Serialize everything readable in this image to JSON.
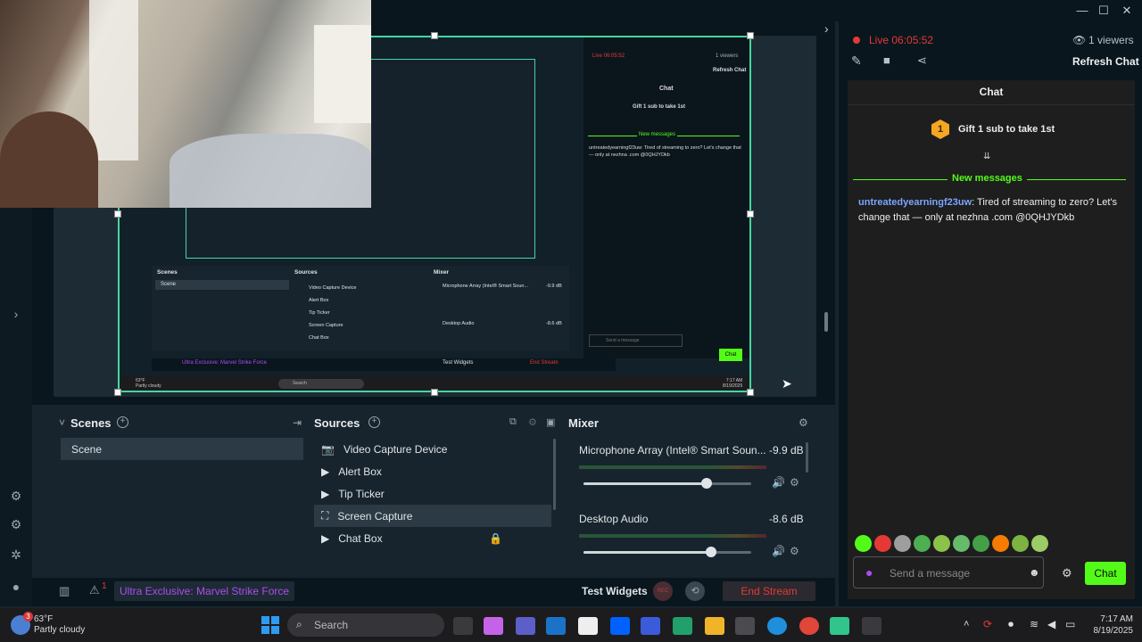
{
  "window": {
    "minimize": "—",
    "maximize": "☐",
    "close": "✕"
  },
  "status": {
    "live_time": "Live 06:05:52",
    "viewers": "1 viewers",
    "refresh_chat": "Refresh Chat"
  },
  "chat": {
    "title": "Chat",
    "gift_badge": "1",
    "gift_text": "Gift 1 sub to take 1st",
    "new_messages": "New messages",
    "messages": [
      {
        "user": "untreatedyearningf23uw",
        "text": ": Tired of streaming to zero? Let's change that — only at nezhna .com @0QHJYDkb"
      }
    ],
    "input_placeholder": "Send a message",
    "send_label": "Chat"
  },
  "scenes": {
    "title": "Scenes",
    "items": [
      "Scene"
    ]
  },
  "sources": {
    "title": "Sources",
    "items": [
      {
        "label": "Video Capture Device",
        "icon": "camera-icon"
      },
      {
        "label": "Alert Box",
        "icon": "alert-icon"
      },
      {
        "label": "Tip Ticker",
        "icon": "ticker-icon"
      },
      {
        "label": "Screen Capture",
        "icon": "screen-icon"
      },
      {
        "label": "Chat Box",
        "icon": "chat-icon"
      }
    ]
  },
  "mixer": {
    "title": "Mixer",
    "channels": [
      {
        "name": "Microphone Array (Intel® Smart Soun...",
        "db": "-9.9 dB",
        "level": 0.77
      },
      {
        "name": "Desktop Audio",
        "db": "-8.6 dB",
        "level": 0.79
      }
    ]
  },
  "footer": {
    "alerts_count": "1",
    "stream_title": "Ultra Exclusive: Marvel Strike Force",
    "test_widgets": "Test Widgets",
    "rec_label": "REC",
    "end_stream": "End Stream"
  },
  "nested": {
    "live": "Live 06:05:52",
    "viewers": "1 viewers",
    "refresh": "Refresh Chat",
    "chat": "Chat",
    "gift": "Gift 1 sub to take 1st",
    "new_messages": "New messages",
    "message": "untreatedyearningf23uw: Tired of streaming to zero? Let's change that — only at nezhna .com @0QHJYDkb",
    "send_placeholder": "Send a message",
    "send": "Chat",
    "scenes": "Scenes",
    "scene": "Scene",
    "sources": "Sources",
    "sources_items": [
      "Video Capture Device",
      "Alert Box",
      "Tip Ticker",
      "Screen Capture",
      "Chat Box"
    ],
    "mixer": "Mixer",
    "mic": "Microphone Array (Intel® Smart Soun...",
    "mic_db": "-9.9 dB",
    "desktop": "Desktop Audio",
    "desktop_db": "-8.6 dB",
    "stream_title": "Ultra Exclusive: Marvel Strike Force",
    "test_widgets": "Test Widgets",
    "end_stream": "End Stream",
    "weather_temp": "63°F",
    "weather_desc": "Partly cloudy",
    "search": "Search",
    "time": "7:17 AM",
    "date": "8/19/2025"
  },
  "taskbar": {
    "weather_temp": "63°F",
    "weather_desc": "Partly cloudy",
    "weather_badge": "3",
    "search_placeholder": "Search",
    "time": "7:17 AM",
    "date": "8/19/2025"
  },
  "colors": {
    "accent_green": "#53fc18",
    "live_red": "#e53935",
    "purple": "#b04bf0",
    "selection": "#44d7a0"
  }
}
